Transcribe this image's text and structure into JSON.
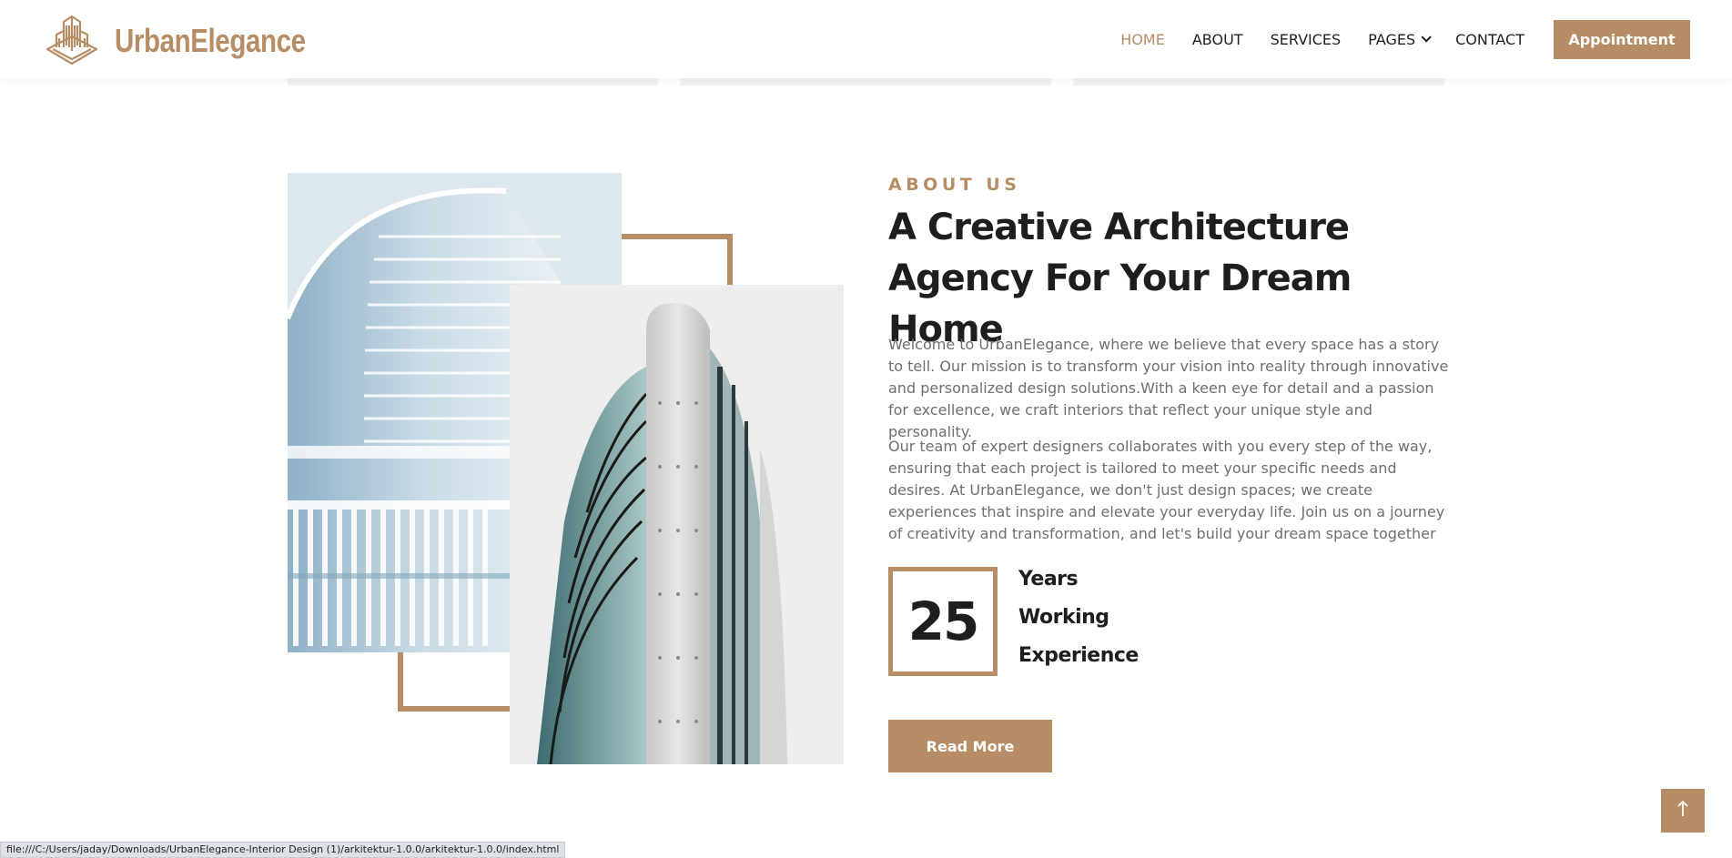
{
  "brand": {
    "name": "UrbanElegance",
    "accent_color": "#b78d65",
    "logo_icon": "building-logo-icon"
  },
  "nav": {
    "items": [
      {
        "label": "HOME",
        "active": true
      },
      {
        "label": "ABOUT"
      },
      {
        "label": "SERVICES"
      },
      {
        "label": "PAGES"
      },
      {
        "label": "CONTACT"
      }
    ],
    "cta_label": "Appointment"
  },
  "about": {
    "eyebrow": "ABOUT US",
    "heading": "A Creative Architecture Agency For Your Dream Home",
    "paragraph_1": "Welcome to UrbanElegance, where we believe that every space has a story to tell. Our mission is to transform your vision into reality through innovative and personalized design solutions.With a keen eye for detail and a passion for excellence, we craft interiors that reflect your unique style and personality.",
    "paragraph_2": "Our team of expert designers collaborates with you every step of the way, ensuring that each project is tailored to meet your specific needs and desires. At UrbanElegance, we don't just design spaces; we create experiences that inspire and elevate your everyday life. Join us on a journey of creativity and transformation, and let's build your dream space together",
    "years_number": "25",
    "years_line_1": "Years",
    "years_line_2": "Working",
    "years_line_3": "Experience",
    "read_more_label": "Read More"
  },
  "status_bar": {
    "url": "file:///C:/Users/jaday/Downloads/UrbanElegance-Interior Design (1)/arkitektur-1.0.0/arkitektur-1.0.0/index.html"
  },
  "icons": {
    "back_to_top": "arrow-up-icon",
    "dropdown": "chevron-down-icon"
  }
}
